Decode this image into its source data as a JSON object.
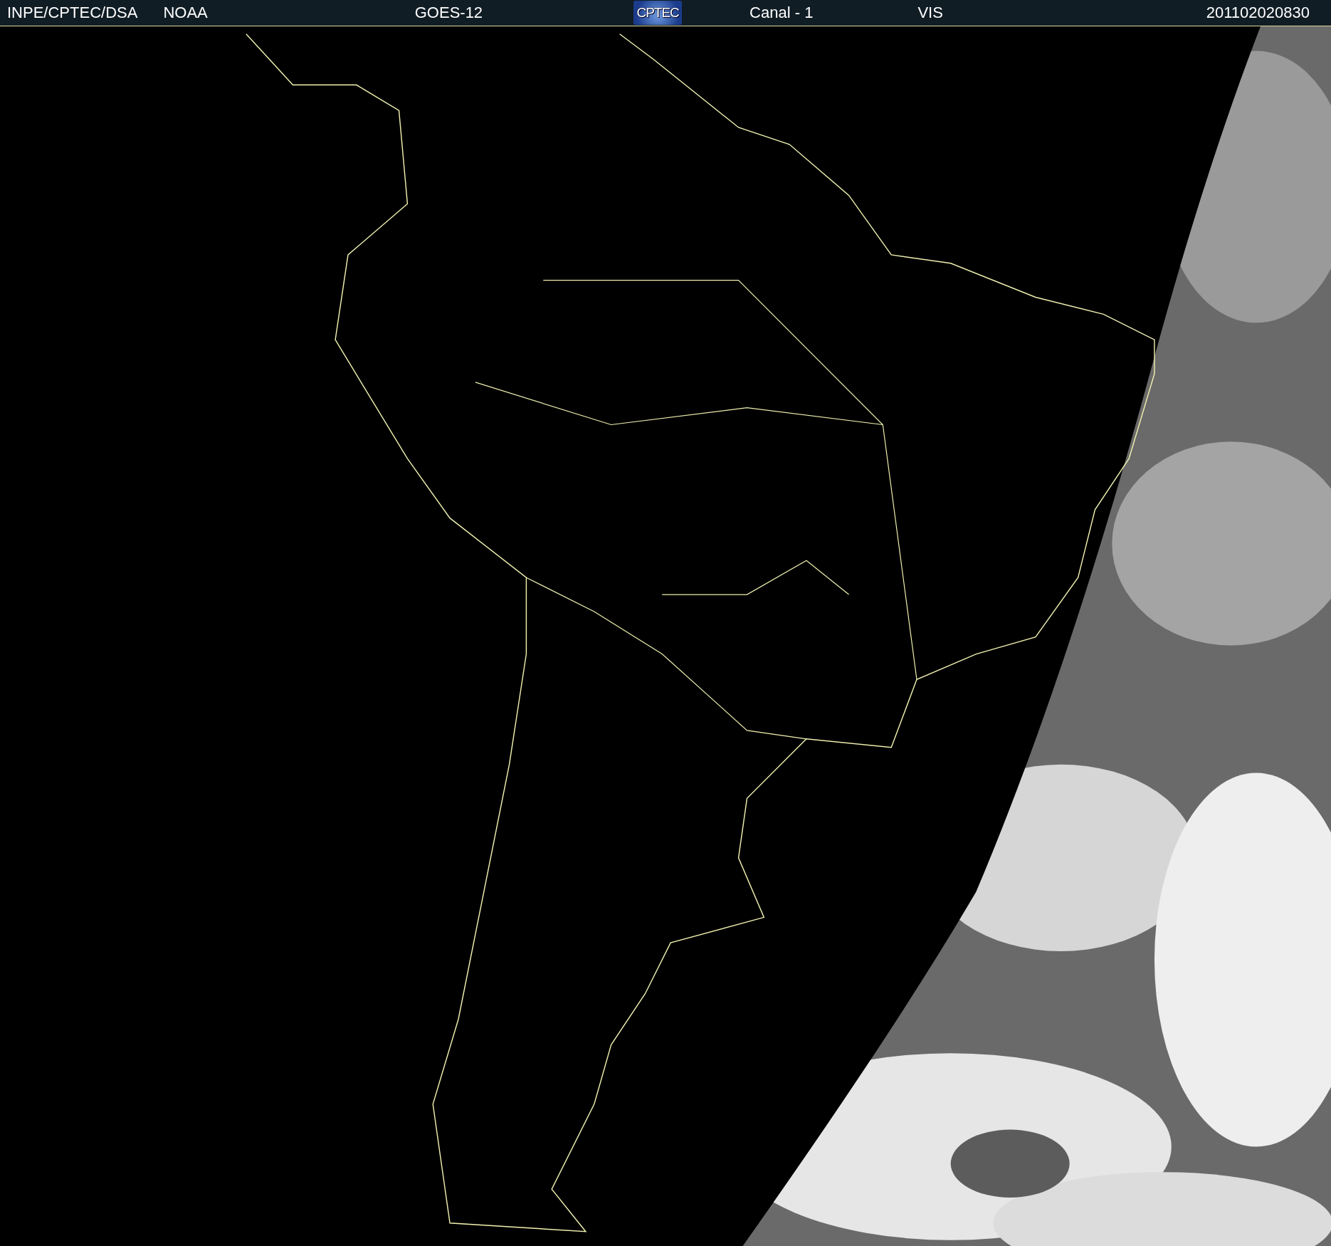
{
  "header": {
    "source": "INPE/CPTEC/DSA",
    "agency": "NOAA",
    "satellite": "GOES-12",
    "logo": "CPTEC",
    "channel": "Canal - 1",
    "band": "VIS",
    "timestamp": "201102020830"
  }
}
